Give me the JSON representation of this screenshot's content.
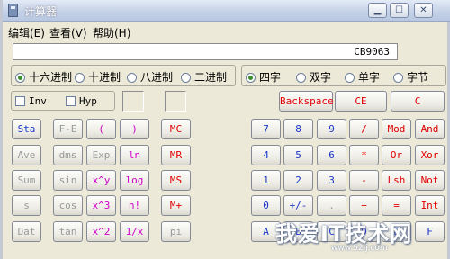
{
  "window": {
    "title": "计算器",
    "controls": {
      "minimize": "▁",
      "maximize": "☐",
      "close": "✕"
    }
  },
  "menu": [
    "编辑(E)",
    "查看(V)",
    "帮助(H)"
  ],
  "display": {
    "value": "CB9063"
  },
  "base_modes": {
    "options": [
      "十六进制",
      "十进制",
      "八进制",
      "二进制"
    ],
    "selected": "十六进制"
  },
  "word_sizes": {
    "options": [
      "四字",
      "双字",
      "单字",
      "字节"
    ],
    "selected": "四字"
  },
  "checks": {
    "inv": "Inv",
    "hyp": "Hyp"
  },
  "edit_buttons": {
    "backspace": "Backspace",
    "ce": "CE",
    "c": "C"
  },
  "stat_buttons": [
    "Sta",
    "Ave",
    "Sum",
    "s",
    "Dat"
  ],
  "func_buttons": [
    [
      "F-E",
      "(",
      ")"
    ],
    [
      "dms",
      "Exp",
      "ln"
    ],
    [
      "sin",
      "x^y",
      "log"
    ],
    [
      "cos",
      "x^3",
      "n!"
    ],
    [
      "tan",
      "x^2",
      "1/x"
    ]
  ],
  "mem_buttons": [
    "MC",
    "MR",
    "MS",
    "M+",
    "pi"
  ],
  "keypad": [
    [
      "7",
      "8",
      "9",
      "/",
      "Mod",
      "And"
    ],
    [
      "4",
      "5",
      "6",
      "*",
      "Or",
      "Xor"
    ],
    [
      "1",
      "2",
      "3",
      "-",
      "Lsh",
      "Not"
    ],
    [
      "0",
      "+/-",
      ".",
      "+",
      "=",
      "Int"
    ],
    [
      "A",
      "B",
      "C",
      "D",
      "E",
      "F"
    ]
  ],
  "watermark": {
    "text": "我爱IT技术网",
    "url": "www.52ij.com"
  }
}
